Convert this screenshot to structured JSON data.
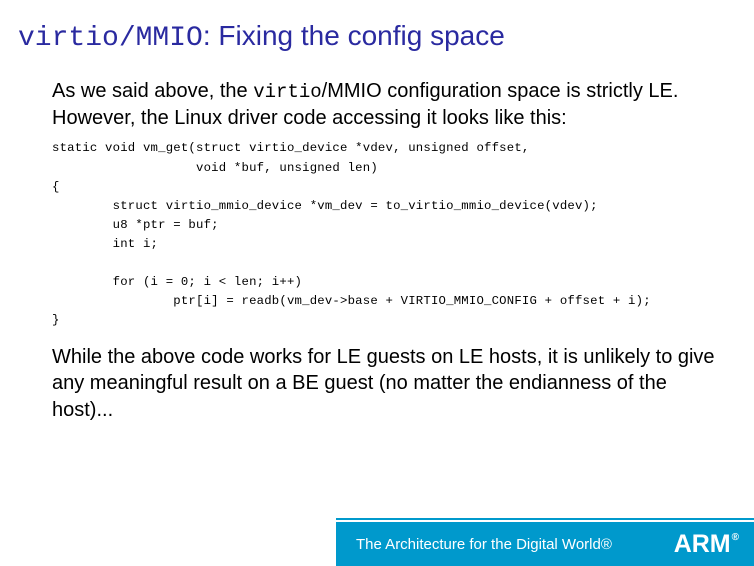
{
  "title": {
    "code_part": "virtio",
    "slash_part": "/MMIO",
    "plain_part": ": Fixing the config space"
  },
  "para1": {
    "t1": "As we said above, the ",
    "tt1": "virtio",
    "t2": "/MMIO configuration space is strictly LE. However, the Linux driver code accessing it looks like this:"
  },
  "code": "static void vm_get(struct virtio_device *vdev, unsigned offset,\n                   void *buf, unsigned len)\n{\n        struct virtio_mmio_device *vm_dev = to_virtio_mmio_device(vdev);\n        u8 *ptr = buf;\n        int i;\n\n        for (i = 0; i < len; i++)\n                ptr[i] = readb(vm_dev->base + VIRTIO_MMIO_CONFIG + offset + i);\n}",
  "para2": "While the above code works for LE guests on LE hosts, it is unlikely to give any meaningful result on a BE guest (no matter the endianness of the host)...",
  "footer": {
    "tagline": "The Architecture for the Digital World®",
    "logo": "ARM",
    "reg": "®"
  }
}
